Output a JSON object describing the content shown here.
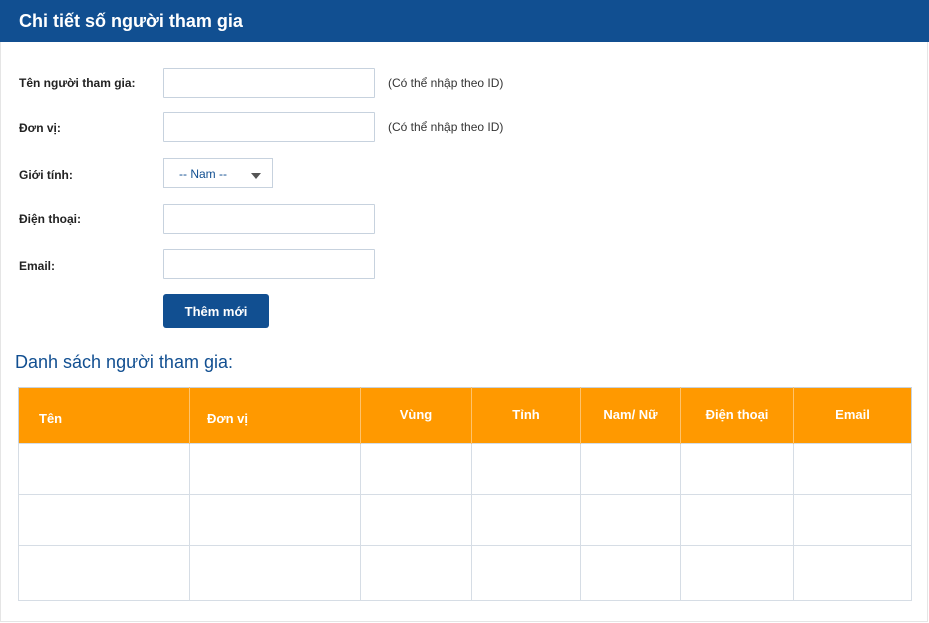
{
  "header": {
    "title": "Chi tiết số người tham gia"
  },
  "form": {
    "name_label": "Tên người tham gia:",
    "name_value": "",
    "name_hint": "(Có thể nhập theo ID)",
    "unit_label": "Đơn vị:",
    "unit_value": "",
    "unit_hint": "(Có thể nhập theo ID)",
    "gender_label": "Giới tính:",
    "gender_selected": "-- Nam --",
    "phone_label": "Điện thoại:",
    "phone_value": "",
    "email_label": "Email:",
    "email_value": "",
    "add_button": "Thêm mới"
  },
  "list": {
    "title": "Danh sách người tham gia:",
    "columns": [
      "Tên",
      "Đơn vị",
      "Vùng",
      "Tỉnh",
      "Nam/ Nữ",
      "Điện thoại",
      "Email"
    ],
    "rows": [
      [
        "",
        "",
        "",
        "",
        "",
        "",
        ""
      ],
      [
        "",
        "",
        "",
        "",
        "",
        "",
        ""
      ],
      [
        "",
        "",
        "",
        "",
        "",
        "",
        ""
      ]
    ]
  },
  "colors": {
    "primary": "#114f91",
    "table_header": "#ff9900",
    "input_border": "#c7d2de"
  }
}
